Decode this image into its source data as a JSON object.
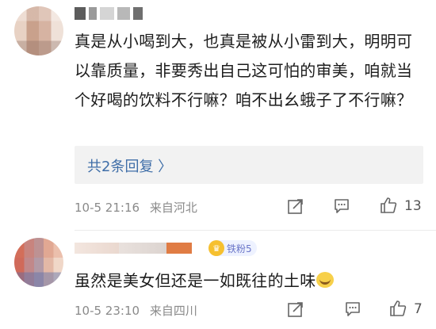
{
  "comments": [
    {
      "text": "真是从小喝到大，也真是被从小雷到大，明明可以靠质量，非要秀出自己这可怕的审美，咱就当个好喝的饮料不行嘛？咱不出幺蛾子了不行嘛？",
      "reply_link": "共2条回复 〉",
      "time": "10-5 21:16",
      "location": "来自河北",
      "like_count": "13"
    },
    {
      "fan_badge": "铁粉5",
      "text": "虽然是美女但还是一如既往的土味",
      "time": "10-5 23:10",
      "location": "来自四川",
      "like_count": "7"
    }
  ]
}
